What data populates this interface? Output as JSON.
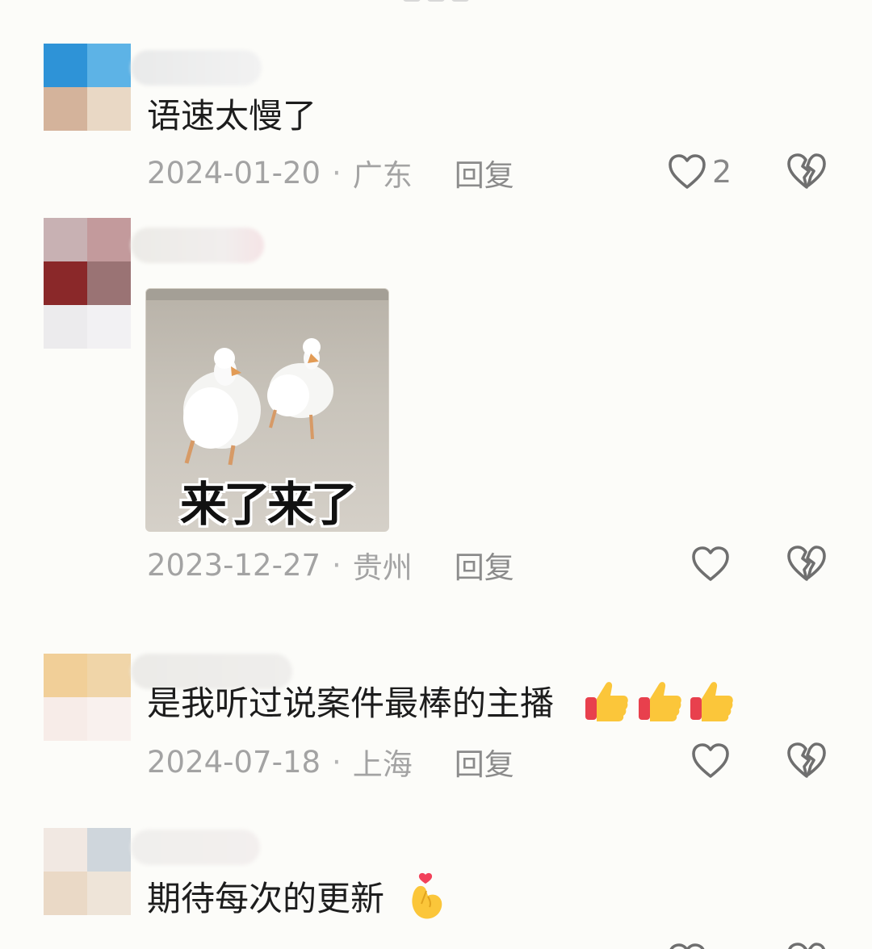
{
  "comments": [
    {
      "text": "语速太慢了",
      "date": "2024-01-20",
      "location": "广东",
      "reply_label": "回复",
      "likes": "2"
    },
    {
      "text": "",
      "date": "2023-12-27",
      "location": "贵州",
      "reply_label": "回复",
      "sticker_caption": "来了来了"
    },
    {
      "text": "是我听过说案件最棒的主播",
      "date": "2024-07-18",
      "location": "上海",
      "reply_label": "回复"
    },
    {
      "text": "期待每次的更新",
      "date": "",
      "location": "",
      "reply_label": "",
      "likes": ""
    }
  ],
  "icons": {
    "like": "heart-outline-icon",
    "dislike": "broken-heart-icon",
    "thumbs_up": "thumbs-up-emoji",
    "finger_heart": "finger-heart-emoji"
  },
  "colors": {
    "background": "#fcfcf9",
    "meta_text": "#a3a3a3",
    "reply_text": "#8b8b8b",
    "icon_stroke": "#6f6f6f"
  }
}
